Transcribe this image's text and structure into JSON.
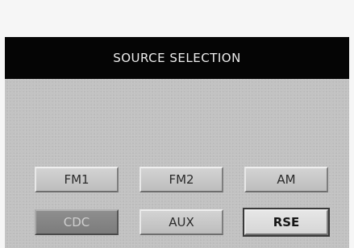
{
  "screen": {
    "title": "SOURCE SELECTION"
  },
  "sources": {
    "fm1": {
      "label": "FM1",
      "state": "normal"
    },
    "fm2": {
      "label": "FM2",
      "state": "normal"
    },
    "am": {
      "label": "AM",
      "state": "normal"
    },
    "cdc": {
      "label": "CDC",
      "state": "disabled"
    },
    "aux": {
      "label": "AUX",
      "state": "normal"
    },
    "rse": {
      "label": "RSE",
      "state": "selected"
    }
  },
  "colors": {
    "title_bar": "#050505",
    "panel": "#c2c2c2",
    "button": "#c8c8c8",
    "button_disabled": "#858585"
  }
}
